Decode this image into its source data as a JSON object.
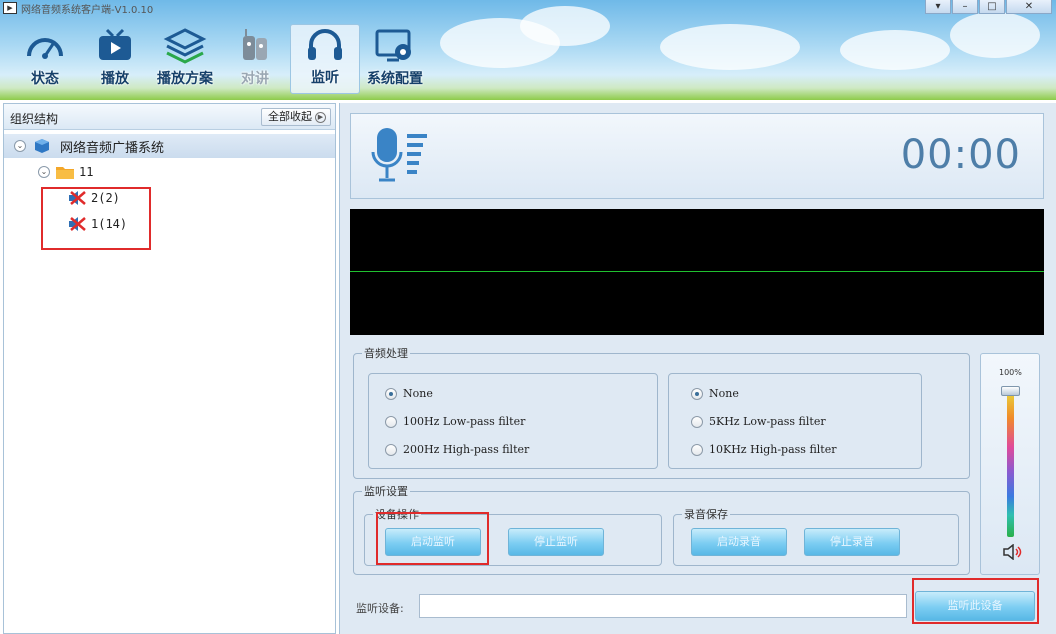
{
  "window": {
    "title": "网络音频系统客户端-V1.0.10",
    "controls": [
      "▾",
      "–",
      "□",
      "✕"
    ]
  },
  "toolbar": {
    "items": [
      {
        "id": "status",
        "label": "状态",
        "icon": "gauge-icon"
      },
      {
        "id": "play",
        "label": "播放",
        "icon": "tv-icon"
      },
      {
        "id": "plan",
        "label": "播放方案",
        "icon": "layers-icon"
      },
      {
        "id": "intercom",
        "label": "对讲",
        "icon": "walkie-talkie-icon",
        "disabled": true
      },
      {
        "id": "monitor",
        "label": "监听",
        "icon": "headphones-icon",
        "active": true
      },
      {
        "id": "config",
        "label": "系统配置",
        "icon": "settings-monitor-icon"
      }
    ]
  },
  "tree_panel": {
    "title": "组织结构",
    "collapse_all": "全部收起",
    "root": "网络音频广播系统",
    "group": "11",
    "terminals": [
      "2(2)",
      "1(14)"
    ]
  },
  "monitor": {
    "timer": "00:00",
    "audio_processing": {
      "legend": "音频处理",
      "left_options": [
        "None",
        "100Hz Low-pass filter",
        "200Hz High-pass filter"
      ],
      "right_options": [
        "None",
        "5KHz Low-pass filter",
        "10KHz High-pass filter"
      ]
    },
    "monitor_settings": {
      "legend": "监听设置",
      "device_ops_legend": "设备操作",
      "start_monitor": "启动监听",
      "stop_monitor": "停止监听",
      "record_legend": "录音保存",
      "start_record": "启动录音",
      "stop_record": "停止录音"
    },
    "volume": {
      "percent": "100%",
      "level": 1.0
    },
    "device": {
      "label": "监听设备:",
      "value": "",
      "button": "监听此设备"
    }
  },
  "colors": {
    "highlight_box": "#e02b2b",
    "scope_line": "#20c030",
    "timer": "#4e7ea8"
  }
}
